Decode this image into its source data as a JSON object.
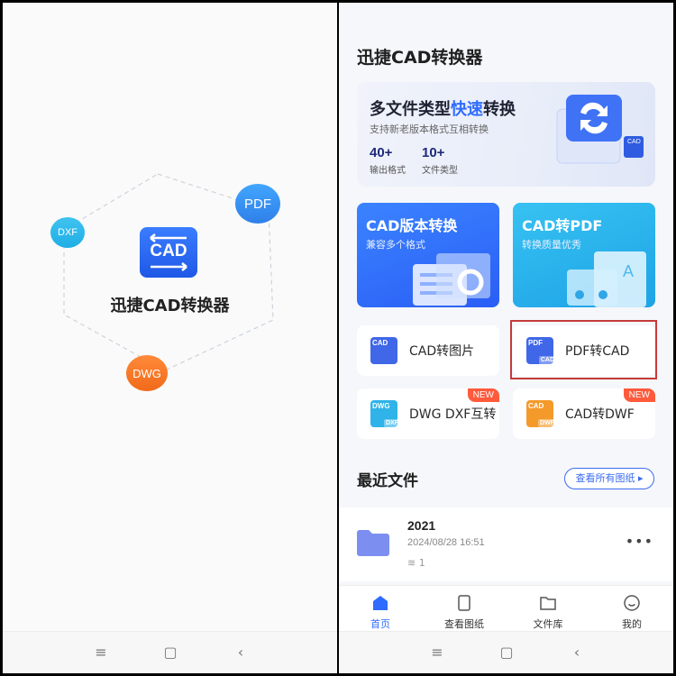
{
  "splash": {
    "title": "迅捷CAD转换器",
    "logo_text": "CAD",
    "bubbles": {
      "pdf": "PDF",
      "dxf": "DXF",
      "dwg": "DWG"
    }
  },
  "home": {
    "app_title": "迅捷CAD转换器",
    "banner": {
      "headline_pre": "多文件类型",
      "headline_hl": "快速",
      "headline_post": "转换",
      "subtitle": "支持新老版本格式互相转换",
      "stats": [
        {
          "num": "40+",
          "label": "输出格式"
        },
        {
          "num": "10+",
          "label": "文件类型"
        }
      ],
      "icon_tag": "CAD"
    },
    "cards": [
      {
        "title": "CAD版本转换",
        "subtitle": "兼容多个格式"
      },
      {
        "title": "CAD转PDF",
        "subtitle": "转换质量优秀"
      }
    ],
    "tools": [
      {
        "label": "CAD转图片",
        "icon_top": "CAD",
        "icon_bottom": "",
        "badge": ""
      },
      {
        "label": "PDF转CAD",
        "icon_top": "PDF",
        "icon_bottom": "CAD",
        "badge": ""
      },
      {
        "label": "DWG DXF互转",
        "icon_top": "DWG",
        "icon_bottom": "DXF",
        "badge": "NEW"
      },
      {
        "label": "CAD转DWF",
        "icon_top": "CAD",
        "icon_bottom": "DWF",
        "badge": "NEW"
      }
    ],
    "recent": {
      "title": "最近文件",
      "view_all": "查看所有图纸 ▸",
      "files": [
        {
          "name": "2021",
          "date": "2024/08/28  16:51",
          "count": "1"
        }
      ]
    },
    "tabs": [
      {
        "label": "首页",
        "icon": "home-icon"
      },
      {
        "label": "查看图纸",
        "icon": "document-icon"
      },
      {
        "label": "文件库",
        "icon": "folder-icon"
      },
      {
        "label": "我的",
        "icon": "smiley-icon"
      }
    ]
  },
  "colors": {
    "accent": "#2f6bff",
    "badge": "#ff5a3c",
    "highlight": "#c63a3a"
  }
}
